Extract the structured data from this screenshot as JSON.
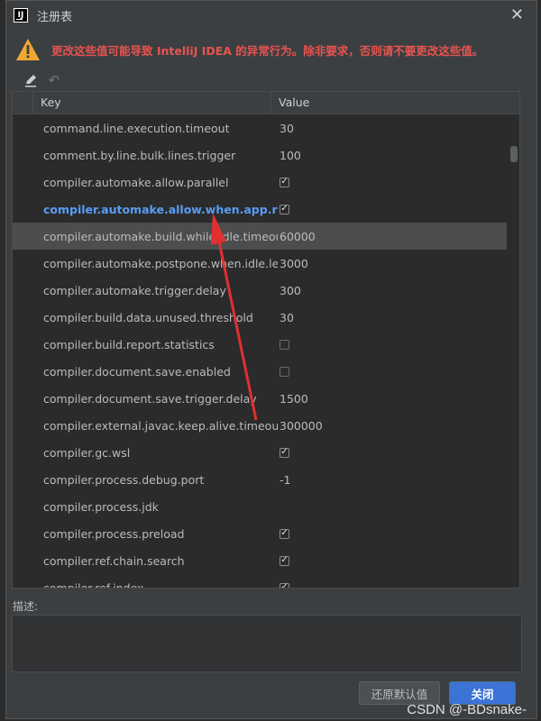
{
  "window": {
    "title": "注册表",
    "app_icon_label": "IJ"
  },
  "warning": {
    "text": "更改这些值可能导致 IntelliJ IDEA 的异常行为。除非要求，否则请不要更改这些值。"
  },
  "table": {
    "columns": {
      "key": "Key",
      "value": "Value"
    },
    "rows": [
      {
        "key": "command.line.execution.timeout",
        "value": "30",
        "type": "text"
      },
      {
        "key": "comment.by.line.bulk.lines.trigger",
        "value": "100",
        "type": "text"
      },
      {
        "key": "compiler.automake.allow.parallel",
        "value": "",
        "type": "checkbox",
        "checked": true
      },
      {
        "key": "compiler.automake.allow.when.app.running",
        "value": "",
        "type": "checkbox",
        "checked": true,
        "bold": true
      },
      {
        "key": "compiler.automake.build.while.idle.timeout",
        "value": "60000",
        "type": "text",
        "selected": true
      },
      {
        "key": "compiler.automake.postpone.when.idle.less.than",
        "value": "3000",
        "type": "text"
      },
      {
        "key": "compiler.automake.trigger.delay",
        "value": "300",
        "type": "text"
      },
      {
        "key": "compiler.build.data.unused.threshold",
        "value": "30",
        "type": "text"
      },
      {
        "key": "compiler.build.report.statistics",
        "value": "",
        "type": "checkbox",
        "checked": false
      },
      {
        "key": "compiler.document.save.enabled",
        "value": "",
        "type": "checkbox",
        "checked": false
      },
      {
        "key": "compiler.document.save.trigger.delay",
        "value": "1500",
        "type": "text"
      },
      {
        "key": "compiler.external.javac.keep.alive.timeout",
        "value": "300000",
        "type": "text"
      },
      {
        "key": "compiler.gc.wsl",
        "value": "",
        "type": "checkbox",
        "checked": true
      },
      {
        "key": "compiler.process.debug.port",
        "value": "-1",
        "type": "text"
      },
      {
        "key": "compiler.process.jdk",
        "value": "",
        "type": "text"
      },
      {
        "key": "compiler.process.preload",
        "value": "",
        "type": "checkbox",
        "checked": true
      },
      {
        "key": "compiler.ref.chain.search",
        "value": "",
        "type": "checkbox",
        "checked": true
      },
      {
        "key": "compiler.ref.index",
        "value": "",
        "type": "checkbox",
        "checked": true
      }
    ]
  },
  "description": {
    "label": "描述:",
    "value": ""
  },
  "buttons": {
    "restore_defaults": "还原默认值",
    "close": "关闭"
  },
  "watermark": "CSDN @-BDsnake-",
  "colors": {
    "warning_text": "#e8534f",
    "bold_key": "#589df6",
    "arrow": "#e03030",
    "primary_button": "#3b73d6"
  }
}
